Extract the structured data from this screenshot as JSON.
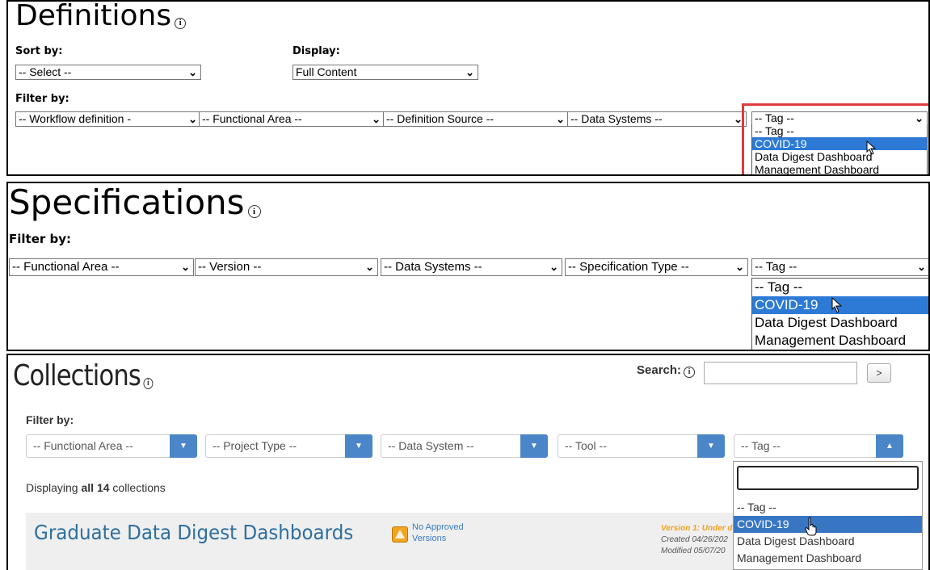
{
  "definitions": {
    "title": "Definitions",
    "sort_label": "Sort by:",
    "sort_value": "-- Select --",
    "display_label": "Display:",
    "display_value": "Full Content",
    "filter_label": "Filter by:",
    "filters": [
      "-- Workflow definition -",
      "-- Functional Area --",
      "-- Definition Source --",
      "-- Data Systems --",
      "-- Tag --"
    ],
    "tag_options": [
      "-- Tag --",
      "COVID-19",
      "Data Digest Dashboard",
      "Management Dashboard"
    ]
  },
  "specifications": {
    "title": "Specifications",
    "filter_label": "Filter by:",
    "filters": [
      "-- Functional Area --",
      "-- Version --",
      "-- Data Systems --",
      "-- Specification Type --",
      "-- Tag --"
    ],
    "tag_options": [
      "-- Tag --",
      "COVID-19",
      "Data Digest Dashboard",
      "Management Dashboard"
    ]
  },
  "collections": {
    "title": "Collections",
    "search_label": "Search:",
    "search_button": ">",
    "filter_label": "Filter by:",
    "filters": [
      "-- Functional Area --",
      "-- Project Type --",
      "-- Data System --",
      "-- Tool --",
      "-- Tag --"
    ],
    "displaying_prefix": "Displaying ",
    "displaying_bold": "all 14",
    "displaying_suffix": " collections",
    "tag_options": [
      "-- Tag --",
      "COVID-19",
      "Data Digest Dashboard",
      "Management Dashboard"
    ],
    "item": {
      "title": "Graduate Data Digest Dashboards",
      "approval_line1": "No Approved",
      "approval_line2": "Versions",
      "version_text": "Version 1: Under d",
      "created": "Created 04/26/202",
      "modified": "Modified 05/07/20"
    }
  },
  "colors": {
    "highlight": "#2d7ad6",
    "red_frame": "#e0393e",
    "collection_button": "#4a86c8",
    "collection_title": "#2f6f9f",
    "version_orange": "#f0a020"
  }
}
